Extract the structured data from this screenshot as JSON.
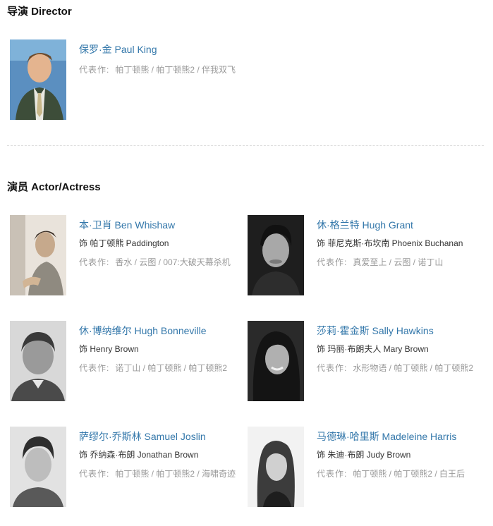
{
  "director_section": {
    "title": "导演 Director",
    "people": [
      {
        "name": "保罗·金 Paul King",
        "works_label": "代表作:",
        "works": "帕丁顿熊 / 帕丁顿熊2 / 伴我双飞"
      }
    ]
  },
  "actor_section": {
    "title": "演员 Actor/Actress",
    "people": [
      {
        "name": "本·卫肖 Ben Whishaw",
        "role": "饰 帕丁顿熊 Paddington",
        "works_label": "代表作:",
        "works": "香水 / 云图 / 007:大破天幕杀机"
      },
      {
        "name": "休·格兰特 Hugh Grant",
        "role": "饰 菲尼克斯·布坎南 Phoenix Buchanan",
        "works_label": "代表作:",
        "works": "真爱至上 / 云图 / 诺丁山"
      },
      {
        "name": "休·博纳维尔 Hugh Bonneville",
        "role": "饰 Henry Brown",
        "works_label": "代表作:",
        "works": "诺丁山 / 帕丁顿熊 / 帕丁顿熊2"
      },
      {
        "name": "莎莉·霍金斯 Sally Hawkins",
        "role": "饰 玛丽·布朗夫人 Mary Brown",
        "works_label": "代表作:",
        "works": "水形物语 / 帕丁顿熊 / 帕丁顿熊2"
      },
      {
        "name": "萨缪尔·乔斯林 Samuel Joslin",
        "role": "饰 乔纳森·布朗 Jonathan Brown",
        "works_label": "代表作:",
        "works": "帕丁顿熊 / 帕丁顿熊2 / 海啸奇迹"
      },
      {
        "name": "马德琳·哈里斯 Madeleine Harris",
        "role": "饰 朱迪·布朗 Judy Brown",
        "works_label": "代表作:",
        "works": "帕丁顿熊 / 帕丁顿熊2 / 白王后"
      }
    ]
  },
  "colors": {
    "link": "#3377aa",
    "muted": "#999999",
    "text": "#333333"
  }
}
